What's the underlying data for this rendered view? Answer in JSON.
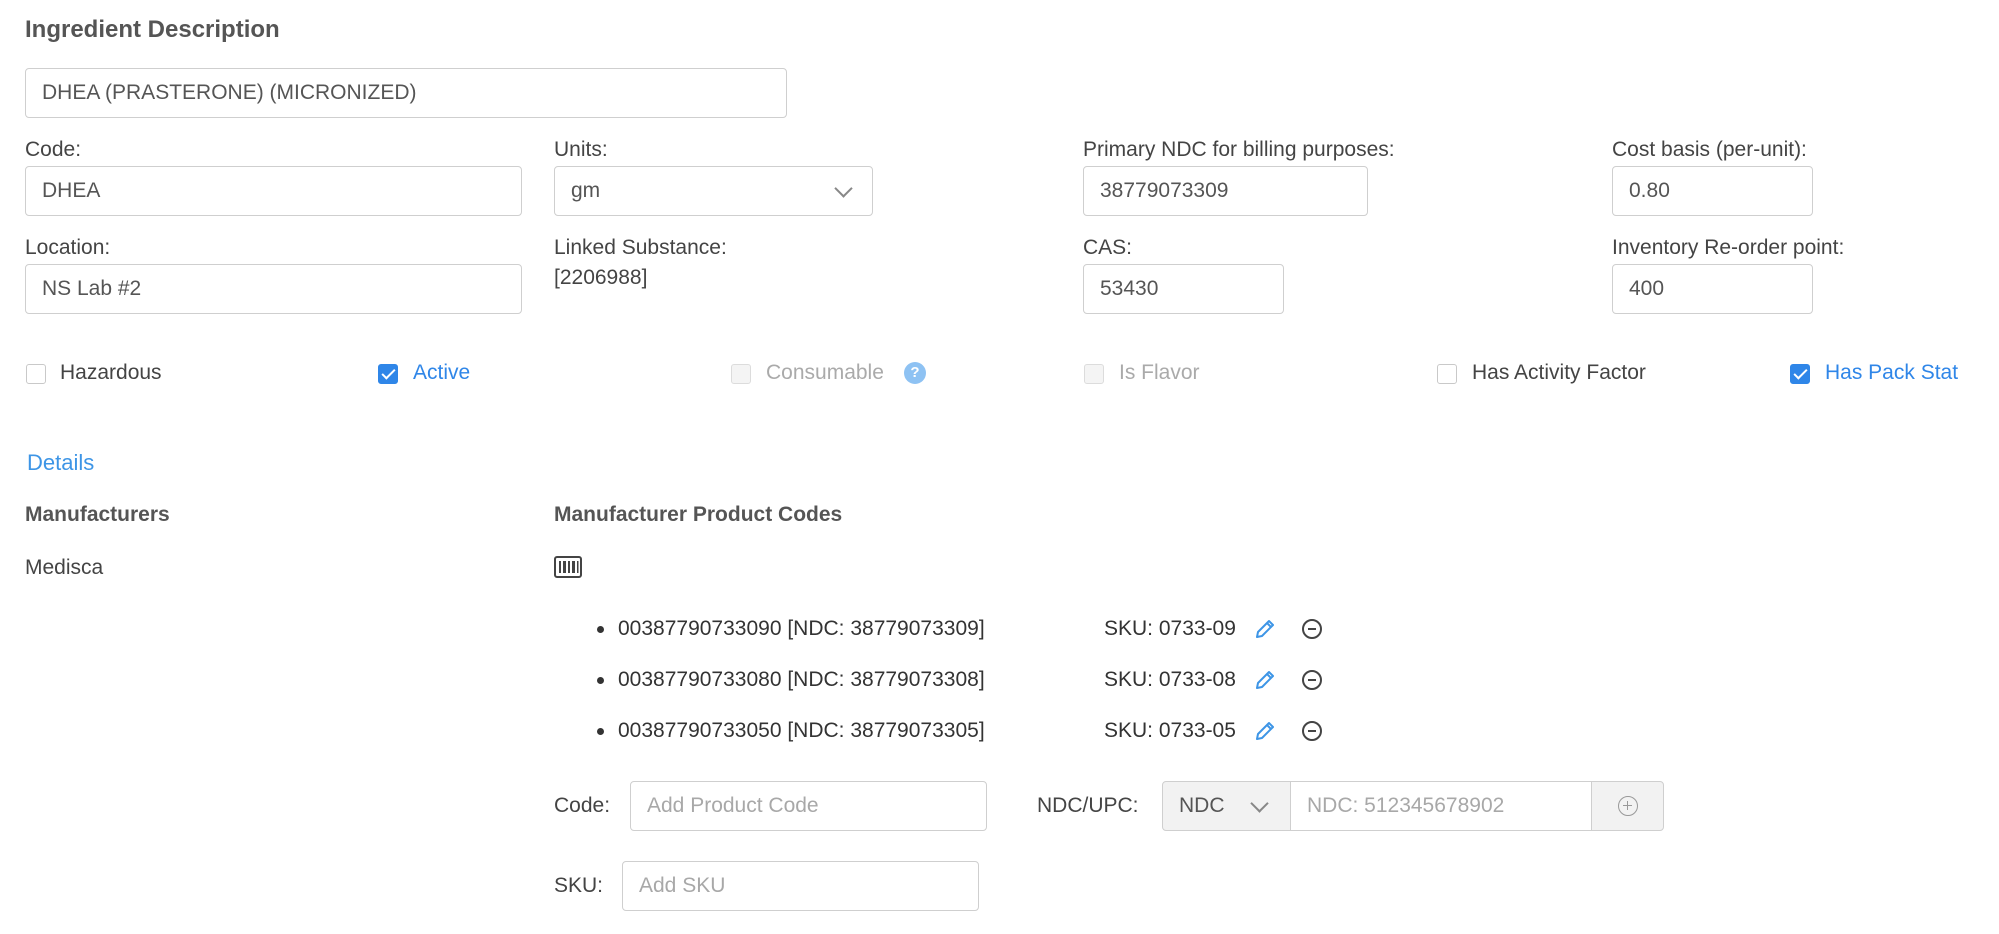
{
  "ingredient": {
    "section_title": "Ingredient Description",
    "description": "DHEA (PRASTERONE) (MICRONIZED)"
  },
  "fields": {
    "code_label": "Code:",
    "code_value": "DHEA",
    "units_label": "Units:",
    "units_value": "gm",
    "primary_ndc_label": "Primary NDC for billing purposes:",
    "primary_ndc_value": "38779073309",
    "cost_basis_label": "Cost basis (per-unit):",
    "cost_basis_value": "0.80",
    "location_label": "Location:",
    "location_value": "NS Lab #2",
    "linked_substance_label": "Linked Substance:",
    "linked_substance_value": "[2206988]",
    "cas_label": "CAS:",
    "cas_value": "53430",
    "reorder_label": "Inventory Re-order point:",
    "reorder_value": "400"
  },
  "checkboxes": {
    "hazardous": {
      "label": "Hazardous",
      "checked": false
    },
    "active": {
      "label": "Active",
      "checked": true
    },
    "consumable": {
      "label": "Consumable",
      "checked": false,
      "help": "?"
    },
    "is_flavor": {
      "label": "Is Flavor",
      "checked": false
    },
    "has_activity_factor": {
      "label": "Has Activity Factor",
      "checked": false
    },
    "has_pack_stat": {
      "label": "Has Pack Stat",
      "checked": true
    }
  },
  "details_link": "Details",
  "manufacturers": {
    "header": "Manufacturers",
    "items": [
      "Medisca"
    ]
  },
  "product_codes": {
    "header": "Manufacturer Product Codes",
    "items": [
      {
        "code": "00387790733090 [NDC: 38779073309]",
        "sku": "SKU: 0733-09"
      },
      {
        "code": "00387790733080 [NDC: 38779073308]",
        "sku": "SKU: 0733-08"
      },
      {
        "code": "00387790733050 [NDC: 38779073305]",
        "sku": "SKU: 0733-05"
      }
    ]
  },
  "add_form": {
    "code_label": "Code:",
    "code_placeholder": "Add Product Code",
    "ndc_upc_label": "NDC/UPC:",
    "type_value": "NDC",
    "ndc_placeholder": "NDC: 512345678902",
    "sku_label": "SKU:",
    "sku_placeholder": "Add SKU"
  },
  "colors": {
    "accent": "#2f86e8",
    "link": "#3d95e6"
  }
}
